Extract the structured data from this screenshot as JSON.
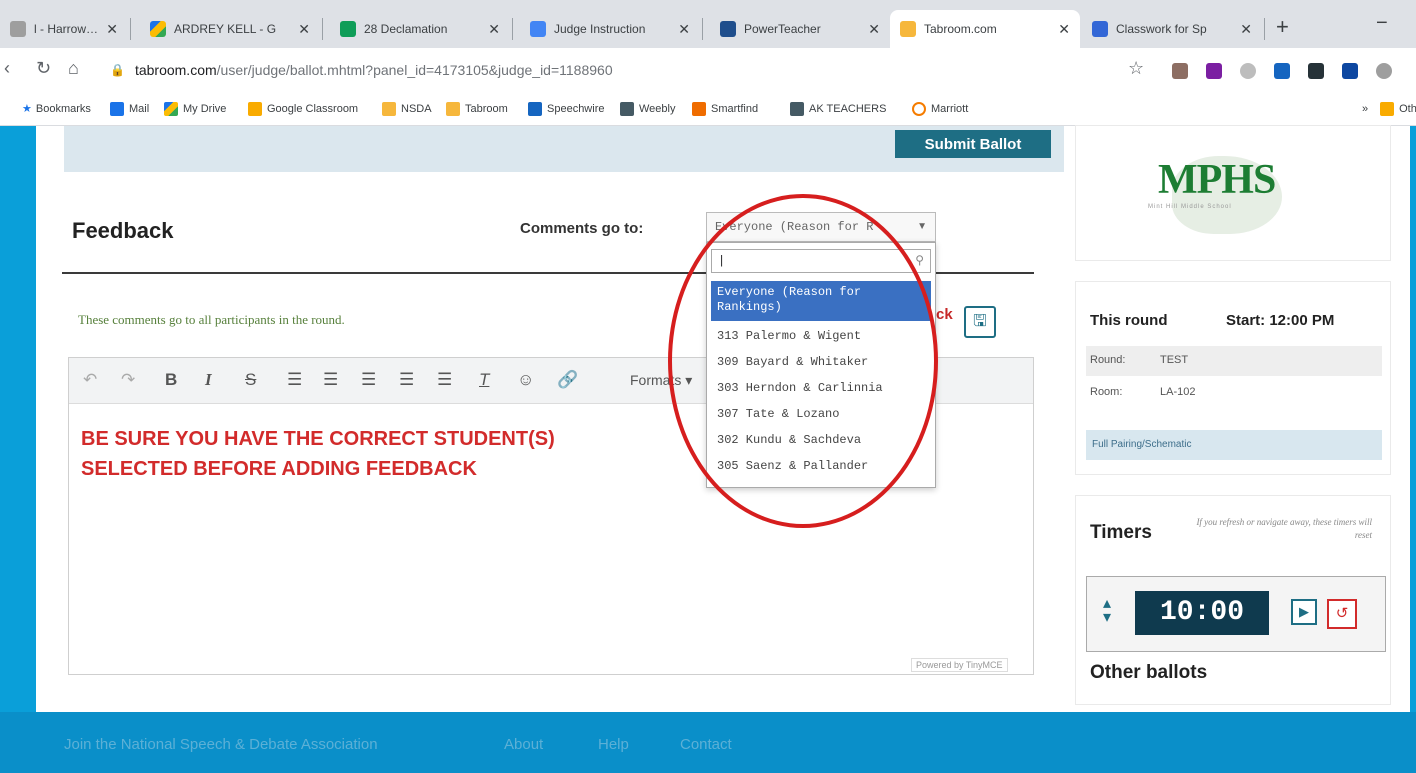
{
  "browser": {
    "tabs": [
      {
        "title": "l - Harrow Ch"
      },
      {
        "title": "ARDREY KELL - G"
      },
      {
        "title": "28 Declamation"
      },
      {
        "title": "Judge Instruction"
      },
      {
        "title": "PowerTeacher"
      },
      {
        "title": "Tabroom.com"
      },
      {
        "title": "Classwork for Sp"
      }
    ],
    "url_host": "tabroom.com",
    "url_path": "/user/judge/ballot.mhtml?panel_id=4173105&judge_id=1188960",
    "bookmarks": [
      "Bookmarks",
      "Mail",
      "My Drive",
      "Google Classroom",
      "NSDA",
      "Tabroom",
      "Speechwire",
      "Weebly",
      "Smartfind",
      "AK TEACHERS",
      "Marriott",
      "Oth"
    ],
    "overflow_chevron": "»"
  },
  "ballot": {
    "submit_label": "Submit Ballot",
    "feedback_title": "Feedback",
    "comments_to_label": "Comments go to:",
    "selected_value": "Everyone (Reason for R",
    "dropdown_search_value": "|",
    "options": [
      {
        "label": "Everyone (Reason for Rankings)"
      },
      {
        "label": "313  Palermo & Wigent"
      },
      {
        "label": "309  Bayard & Whitaker"
      },
      {
        "label": "303  Herndon & Carlinnia"
      },
      {
        "label": "307  Tate & Lozano"
      },
      {
        "label": "302  Kundu & Sachdeva"
      },
      {
        "label": "305  Saenz & Pallander"
      }
    ],
    "all_participants_note": "These comments go to all participants in the round.",
    "save_fragment": "ck",
    "toolbar": {
      "formats_label": "Formats"
    },
    "warning_line1": "BE SURE YOU HAVE THE CORRECT STUDENT(S)",
    "warning_line2": "SELECTED BEFORE ADDING FEEDBACK",
    "powered_by": "Powered by TinyMCE"
  },
  "sidebar": {
    "logo_text": "MPHS",
    "logo_sub": "Mint Hill Middle School",
    "round_title": "This round",
    "start_label": "Start: 12:00 PM",
    "round_label": "Round:",
    "round_value": "TEST",
    "room_label": "Room:",
    "room_value": "LA-102",
    "pairing_link": "Full Pairing/Schematic",
    "timers_title": "Timers",
    "timers_warning": "If you refresh or navigate away, these timers will reset",
    "timer_value": "10:00",
    "other_ballots": "Other ballots"
  },
  "footer": {
    "links": [
      "Join the National Speech & Debate Association",
      "About",
      "Help",
      "Contact"
    ]
  },
  "colors": {
    "page_blue": "#0a9fd9",
    "button_teal": "#1e6e84",
    "warning_red": "#d22b2b",
    "selected_option": "#3a70c2",
    "timer_bg": "#0f3a4e"
  }
}
